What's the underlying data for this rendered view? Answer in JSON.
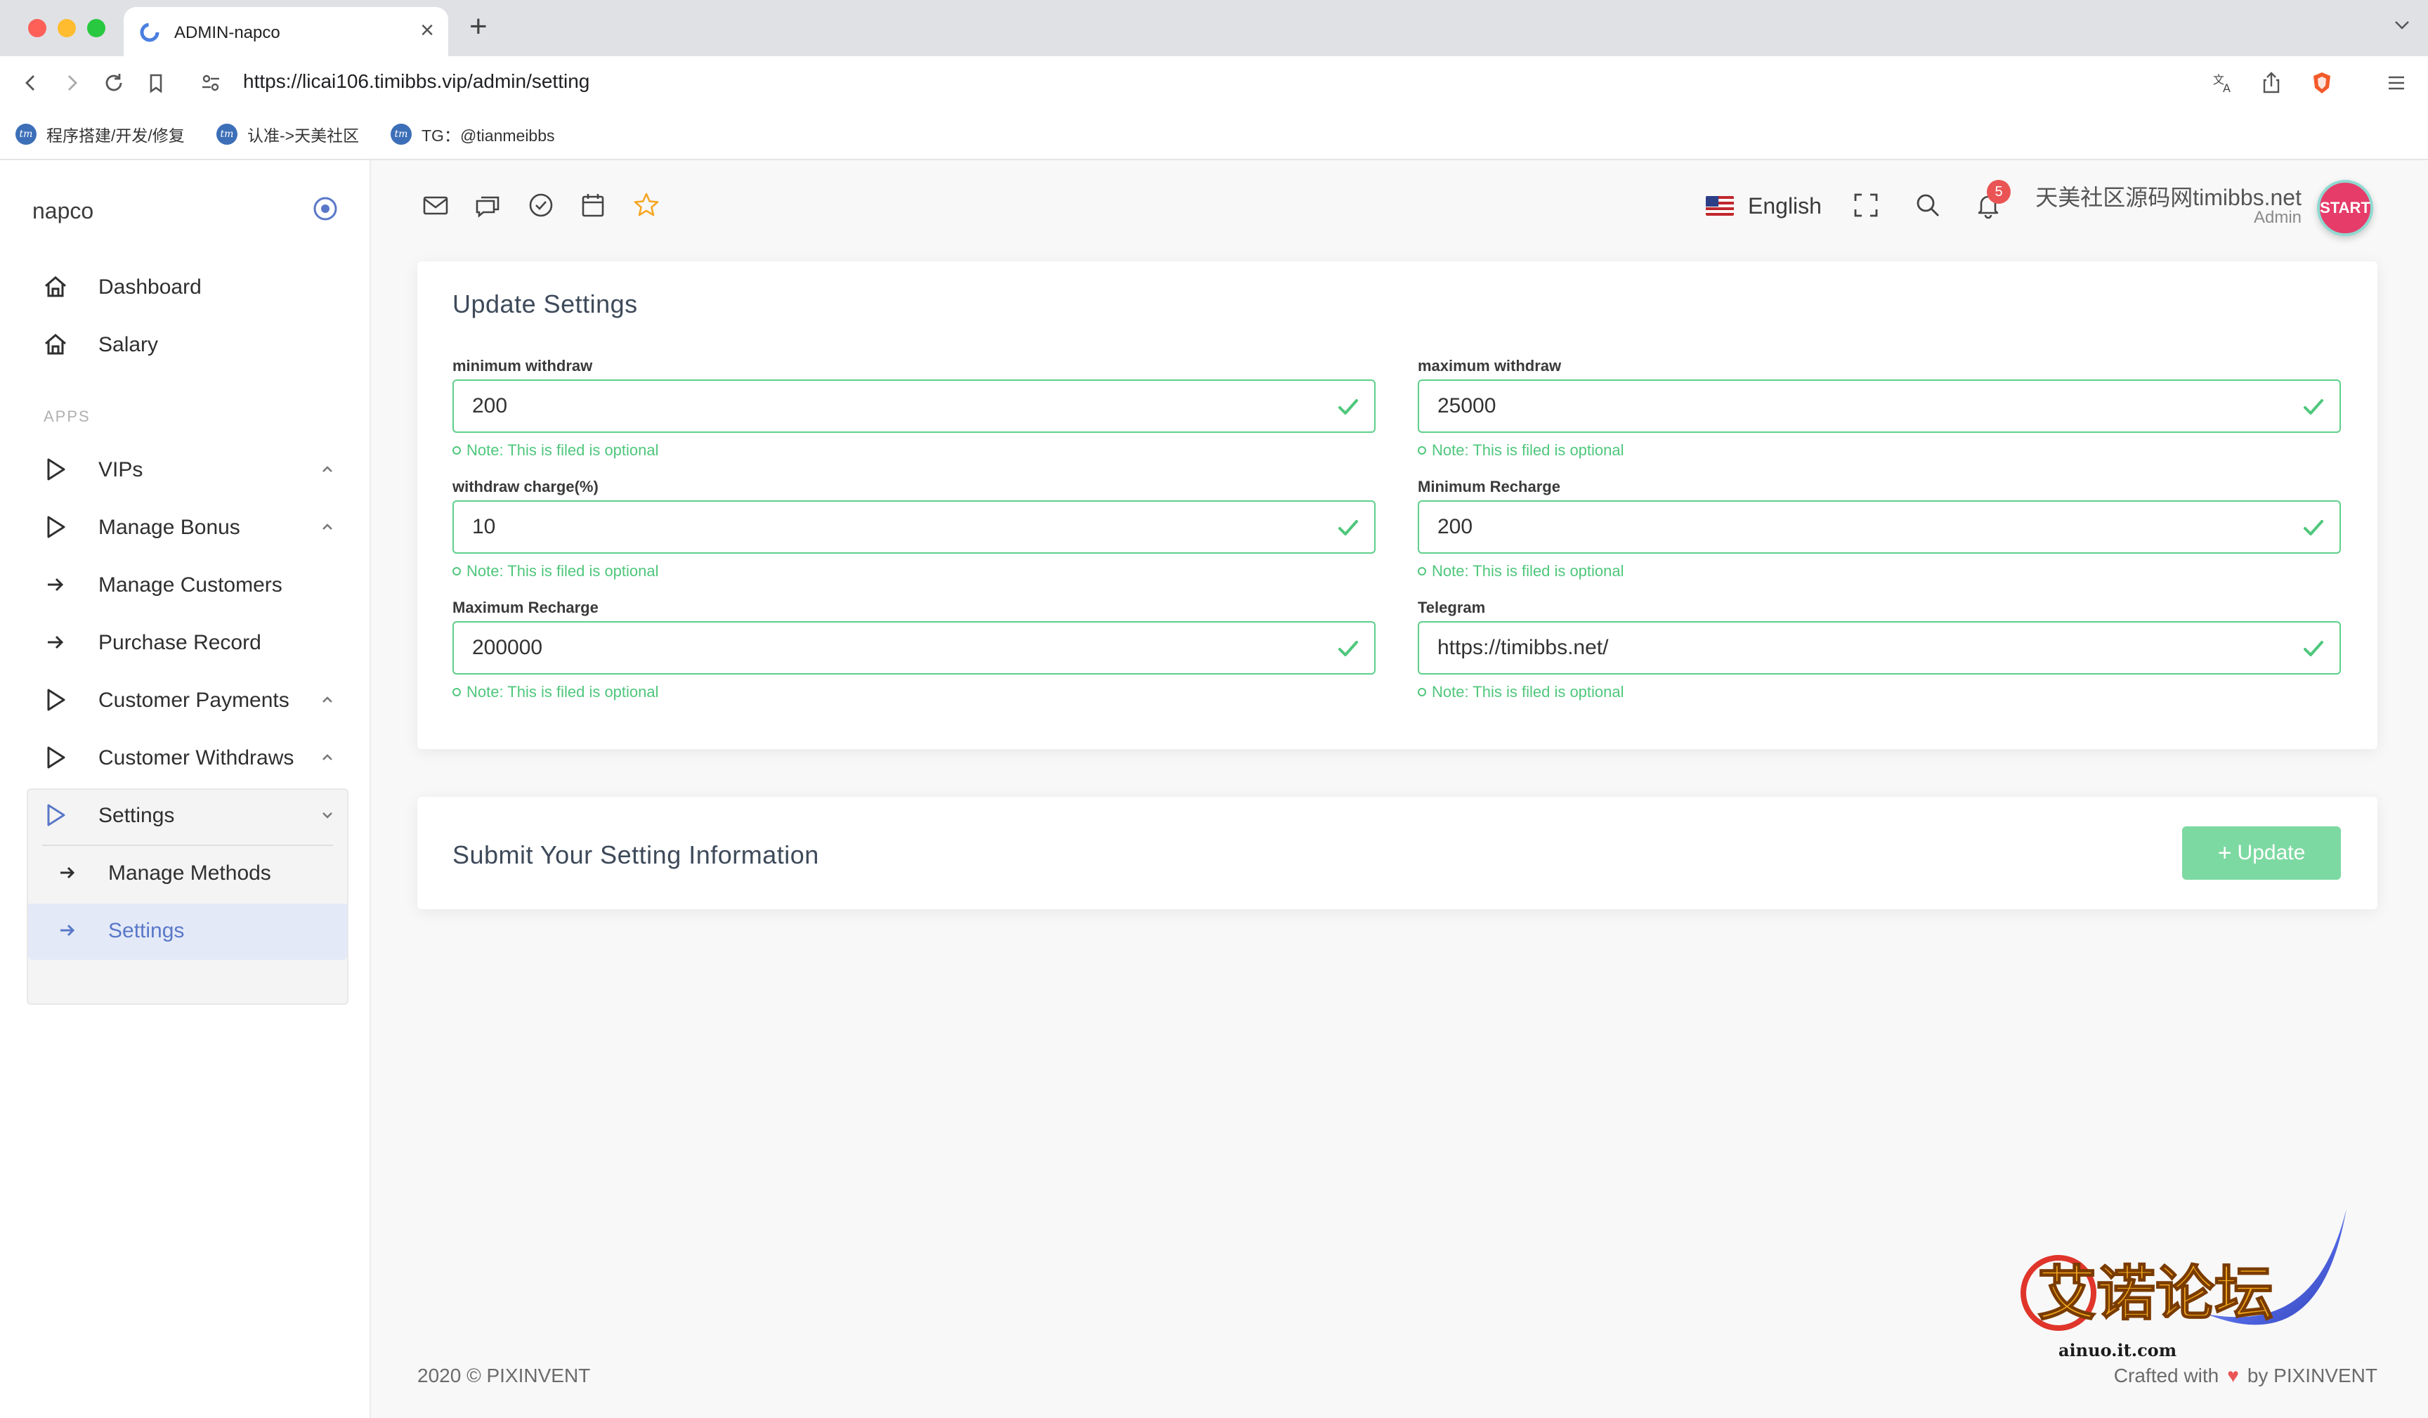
{
  "browser": {
    "tab_title": "ADMIN-napco",
    "tab_close": "×",
    "new_tab": "+",
    "url": "https://licai106.timibbs.vip/admin/setting",
    "bookmarks": [
      {
        "label": "程序搭建/开发/修复",
        "icon": "tm"
      },
      {
        "label": "认准->天美社区",
        "icon": "tm"
      },
      {
        "label": "TG：@tianmeibbs",
        "icon": "tm"
      }
    ]
  },
  "sidebar": {
    "brand": "napco",
    "section_apps": "APPS",
    "items": {
      "dashboard": "Dashboard",
      "salary": "Salary",
      "vips": "VIPs",
      "manage_bonus": "Manage Bonus",
      "manage_customers": "Manage Customers",
      "purchase_record": "Purchase Record",
      "customer_payments": "Customer Payments",
      "customer_withdraws": "Customer Withdraws",
      "settings": "Settings",
      "manage_methods": "Manage Methods",
      "settings_sub": "Settings"
    }
  },
  "header": {
    "language": "English",
    "notification_count": "5",
    "user_name": "天美社区源码网timibbs.net",
    "user_role": "Admin",
    "avatar_text": "START"
  },
  "settings_form": {
    "title": "Update Settings",
    "note": "Note: This is filed is optional",
    "fields": {
      "min_withdraw": {
        "label": "minimum withdraw",
        "value": "200"
      },
      "max_withdraw": {
        "label": "maximum withdraw",
        "value": "25000"
      },
      "withdraw_charge": {
        "label": "withdraw charge(%)",
        "value": "10"
      },
      "min_recharge": {
        "label": "Minimum Recharge",
        "value": "200"
      },
      "max_recharge": {
        "label": "Maximum Recharge",
        "value": "200000"
      },
      "telegram": {
        "label": "Telegram",
        "value": "https://timibbs.net/"
      }
    }
  },
  "submit_card": {
    "title": "Submit Your Setting Information",
    "button": "Update"
  },
  "footer": {
    "copyright": "2020 © PIXINVENT",
    "crafted": "Crafted with",
    "by": "by PIXINVENT"
  },
  "watermark": {
    "text": "艾诺论坛",
    "domain": "ainuo.it.com"
  },
  "colors": {
    "accent": "#5a78c8",
    "success": "#4fc77c",
    "button": "#7dd9a2",
    "badge": "#ea5455"
  }
}
